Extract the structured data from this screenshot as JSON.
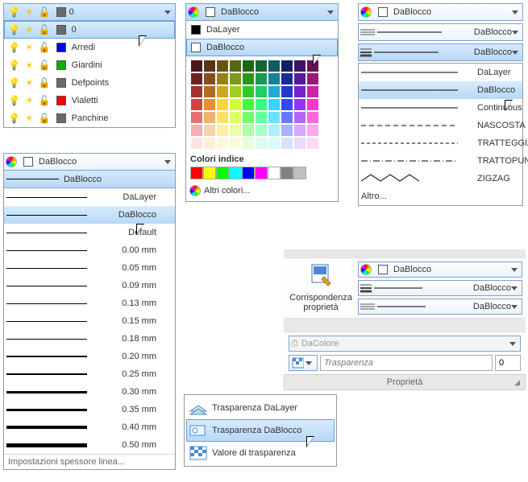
{
  "layers": {
    "current": "0",
    "items": [
      {
        "name": "0",
        "color": "#6b6b6b"
      },
      {
        "name": "Arredi",
        "color": "#0000ff"
      },
      {
        "name": "Giardini",
        "color": "#00b300"
      },
      {
        "name": "Defpoints",
        "color": "#6b6b6b"
      },
      {
        "name": "Vialetti",
        "color": "#ff0000"
      },
      {
        "name": "Panchine",
        "color": "#6b6b6b"
      }
    ]
  },
  "colorDD": {
    "header": "DaBlocco",
    "items": [
      "DaLayer",
      "DaBlocco"
    ],
    "sectionLabel": "Colori indice",
    "moreLabel": "Altri colori...",
    "hoverIndex": 1
  },
  "linetypeDD": {
    "header": "DaBlocco",
    "top1": "DaBlocco",
    "top2": "DaBlocco",
    "list": [
      {
        "label": "DaLayer",
        "dash": "none"
      },
      {
        "label": "DaBlocco",
        "dash": "none",
        "sel": true
      },
      {
        "label": "Continuous",
        "dash": "none"
      },
      {
        "label": "NASCOSTA",
        "dash": "6,4"
      },
      {
        "label": "TRATTEGGIATA",
        "dash": "4,3"
      },
      {
        "label": "TRATTOPUNTO",
        "dash": "8,3,1,3"
      },
      {
        "label": "ZIGZAG",
        "dash": "zig"
      }
    ],
    "moreLabel": "Altro..."
  },
  "lineweightDD": {
    "header": "DaBlocco",
    "items": [
      "DaBlocco",
      "DaLayer",
      "DaBlocco",
      "Default",
      "0.00 mm",
      "0.05 mm",
      "0.09 mm",
      "0.13 mm",
      "0.15 mm",
      "0.18 mm",
      "0.20 mm",
      "0.25 mm",
      "0.30 mm",
      "0.35 mm",
      "0.40 mm",
      "0.50 mm"
    ],
    "weights": [
      1,
      1,
      1,
      1,
      1,
      1,
      1,
      1,
      1,
      1,
      2,
      2,
      3,
      3,
      4,
      5
    ],
    "selIndex": 2,
    "status": "Impostazioni spessore linea..."
  },
  "ribbon": {
    "matchLabel1": "Corrispondenza",
    "matchLabel2": "proprietà",
    "h1": "DaBlocco",
    "h2": "DaBlocco",
    "h3": "DaBlocco",
    "plotStyle": "DaColore",
    "transpPlaceholder": "Trasparenza",
    "transpValue": "0",
    "panelTitle": "Proprietà"
  },
  "transpMenu": {
    "items": [
      {
        "label": "Trasparenza DaLayer"
      },
      {
        "label": "Trasparenza DaBlocco",
        "sel": true
      },
      {
        "label": "Valore di trasparenza"
      }
    ]
  },
  "colorGrid": {
    "hexes": [
      "#4a1919",
      "#5a3112",
      "#665512",
      "#566612",
      "#1c6612",
      "#126636",
      "#125866",
      "#121f66",
      "#3e1266",
      "#661254",
      "#6e2323",
      "#845019",
      "#998119",
      "#7e9919",
      "#279919",
      "#19994e",
      "#198299",
      "#192b99",
      "#5a1999",
      "#99197d",
      "#a33030",
      "#b36b22",
      "#cca822",
      "#a5cc22",
      "#33cc22",
      "#22cc66",
      "#22abcc",
      "#2238cc",
      "#7622cc",
      "#cc22a4",
      "#d64242",
      "#e88f33",
      "#ffd633",
      "#cfff33",
      "#42ff33",
      "#33ff82",
      "#33d6ff",
      "#3347ff",
      "#9433ff",
      "#ff33cd",
      "#e57373",
      "#f0b26b",
      "#ffe066",
      "#ddff66",
      "#73ff66",
      "#66ffa3",
      "#66e5ff",
      "#667aff",
      "#b266ff",
      "#ff66db",
      "#f2b0b0",
      "#f7d5a8",
      "#fff0a8",
      "#edffa8",
      "#b0ffa8",
      "#a8ffca",
      "#a8f2ff",
      "#a8b2ff",
      "#d5a8ff",
      "#ffa8ec",
      "#fde3e3",
      "#fceed9",
      "#fff9d9",
      "#f6ffd9",
      "#e3ffd9",
      "#d9ffe9",
      "#d9f9ff",
      "#d9dfff",
      "#edd9ff",
      "#ffd9f6"
    ],
    "indexHexes": [
      "#ff0000",
      "#ffff00",
      "#00ff00",
      "#00ffff",
      "#0000ff",
      "#ff00ff",
      "#ffffff",
      "#808080",
      "#c0c0c0"
    ]
  }
}
